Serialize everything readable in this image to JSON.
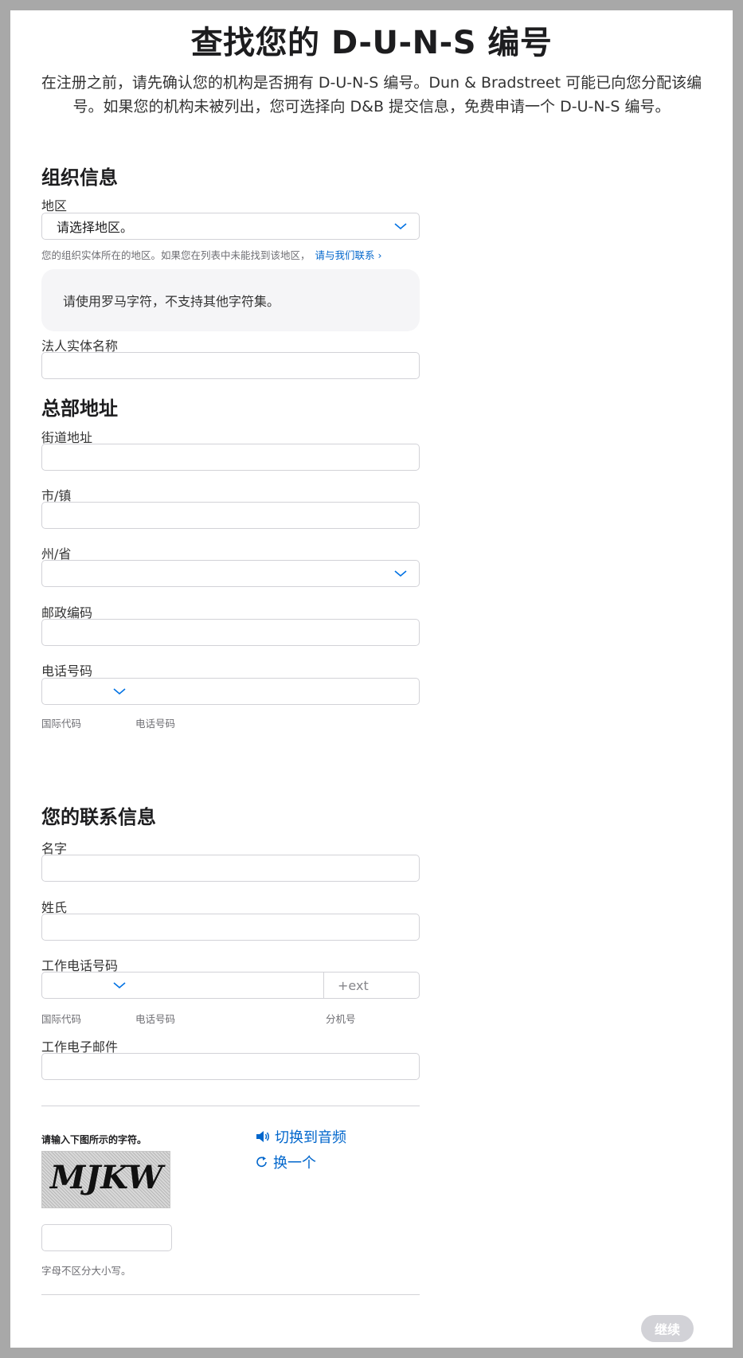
{
  "header": {
    "title": "查找您的 D-U-N-S 编号",
    "intro_line1": "在注册之前，请先确认您的机构是否拥有 D-U-N-S 编号。Dun & Bradstreet 可能已向您分配该编",
    "intro_line2": "号。如果您的机构未被列出，您可选择向 D&B 提交信息，免费申请一个 D-U-N-S 编号。"
  },
  "org_section": {
    "heading": "组织信息",
    "region_label": "地区",
    "region_value": "请选择地区。",
    "region_hint": "您的组织实体所在的地区。如果您在列表中未能找到该地区，",
    "region_hint_link": "请与我们联系 ›",
    "notice": "请使用罗马字符，不支持其他字符集。",
    "legal_name_label": "法人实体名称"
  },
  "hq_section": {
    "heading": "总部地址",
    "street_label": "街道地址",
    "city_label": "市/镇",
    "state_label": "州/省",
    "postal_label": "邮政编码",
    "phone_label": "电话号码",
    "phone_cc_sub": "国际代码",
    "phone_num_sub": "电话号码"
  },
  "contact_section": {
    "heading": "您的联系信息",
    "first_name_label": "名字",
    "last_name_label": "姓氏",
    "work_phone_label": "工作电话号码",
    "ext_placeholder": "+ext",
    "cc_sub": "国际代码",
    "num_sub": "电话号码",
    "ext_sub": "分机号",
    "email_label": "工作电子邮件"
  },
  "captcha": {
    "prompt": "请输入下图所示的字符。",
    "text": "MJKW",
    "audio_link": "切换到音频",
    "refresh_link": "换一个",
    "hint": "字母不区分大小写。"
  },
  "footer": {
    "continue_label": "继续"
  },
  "colors": {
    "accent": "#0066cc",
    "chevron": "#0071e3",
    "disabled_button": "#d2d2d7"
  }
}
